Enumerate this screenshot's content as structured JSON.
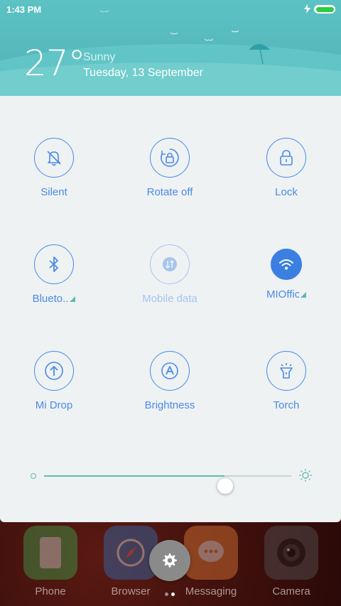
{
  "status": {
    "time": "1:43 PM"
  },
  "weather": {
    "temperature": "27°",
    "condition": "Sunny",
    "date": "Tuesday, 13 September"
  },
  "toggles": [
    {
      "label": "Silent",
      "icon": "bell-off-icon",
      "state": "off"
    },
    {
      "label": "Rotate off",
      "icon": "rotate-lock-icon",
      "state": "off"
    },
    {
      "label": "Lock",
      "icon": "lock-icon",
      "state": "off"
    },
    {
      "label": "Blueto..",
      "icon": "bluetooth-icon",
      "state": "off"
    },
    {
      "label": "Mobile data",
      "icon": "mobile-data-icon",
      "state": "disabled"
    },
    {
      "label": "MIOffice",
      "icon": "wifi-icon",
      "state": "on"
    },
    {
      "label": "Mi Drop",
      "icon": "mi-drop-icon",
      "state": "off"
    },
    {
      "label": "Brightness",
      "icon": "auto-brightness-icon",
      "state": "off"
    },
    {
      "label": "Torch",
      "icon": "torch-icon",
      "state": "off"
    }
  ],
  "brightness": {
    "level": 0.73
  },
  "dock": {
    "apps": [
      {
        "name": "Phone"
      },
      {
        "name": "Browser"
      },
      {
        "name": "Messaging"
      },
      {
        "name": "Camera"
      }
    ]
  },
  "colors": {
    "accent": "#4b8ae8",
    "header": "#56b9bd",
    "slider": "#5fb8b5",
    "panel": "#eef2f3"
  }
}
